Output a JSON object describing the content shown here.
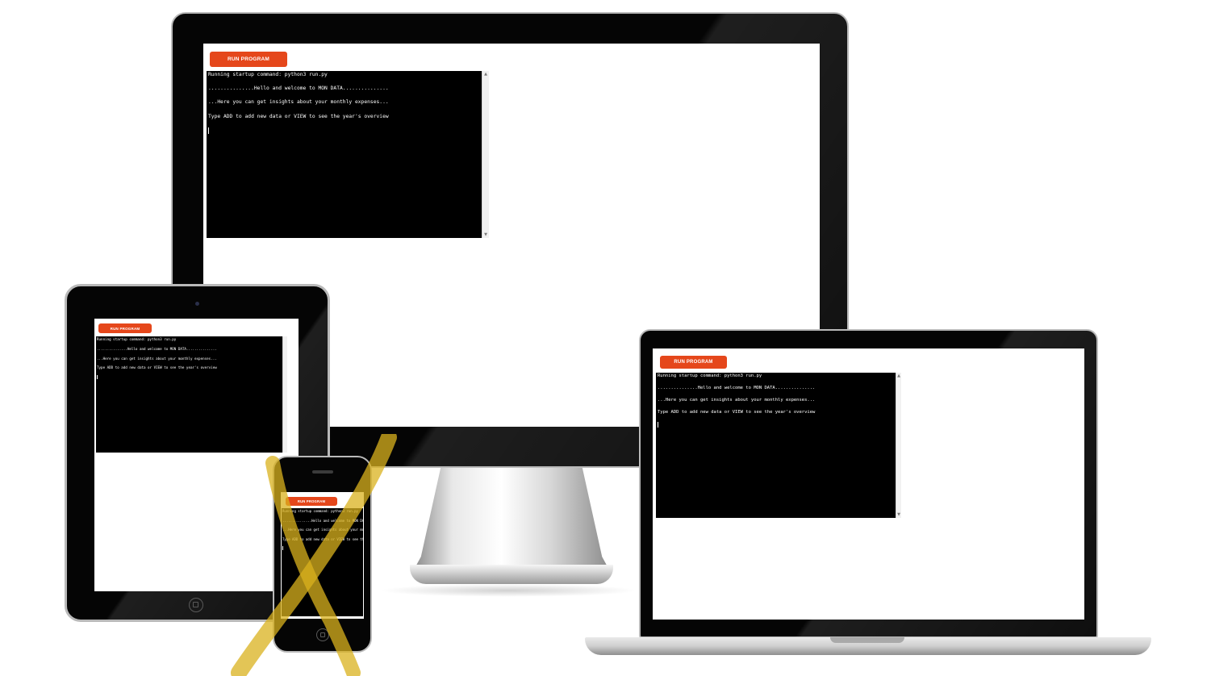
{
  "run_button_label": "RUN PROGRAM",
  "terminal": {
    "lines": [
      "Running startup command: python3 run.py",
      "",
      "...............Hello and welcome to MON DATA...............",
      "",
      "...Here you can get insights about your monthly expenses...",
      "",
      "Type ADD to add new data or VIEW to see the year's overview"
    ]
  },
  "scrollbar": {
    "up_arrow": "▲",
    "down_arrow": "▼"
  },
  "colors": {
    "button_accent": "#e5471b",
    "terminal_bg": "#000000",
    "terminal_fg": "#ffffff",
    "scribble": "#d9b21d"
  },
  "devices": [
    "desktop",
    "laptop",
    "tablet",
    "phone"
  ]
}
